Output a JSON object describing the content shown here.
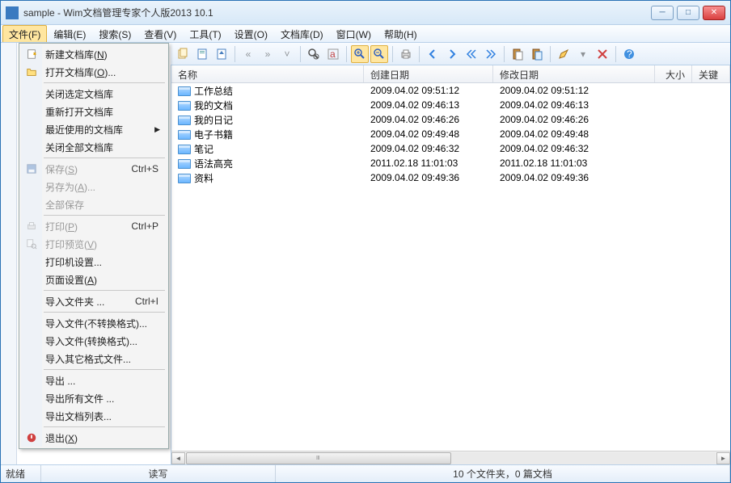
{
  "title": "sample - Wim文档管理专家个人版2013 10.1",
  "menubar": [
    "文件(F)",
    "编辑(E)",
    "搜索(S)",
    "查看(V)",
    "工具(T)",
    "设置(O)",
    "文档库(D)",
    "窗口(W)",
    "帮助(H)"
  ],
  "file_menu": {
    "groups": [
      [
        {
          "label": "新建文档库(N)",
          "icon": "new"
        },
        {
          "label": "打开文档库(O)...",
          "icon": "open"
        }
      ],
      [
        {
          "label": "关闭选定文档库"
        },
        {
          "label": "重新打开文档库"
        },
        {
          "label": "最近使用的文档库",
          "submenu": true
        },
        {
          "label": "关闭全部文档库"
        }
      ],
      [
        {
          "label": "保存(S)",
          "shortcut": "Ctrl+S",
          "icon": "save",
          "disabled": true
        },
        {
          "label": "另存为(A)...",
          "disabled": true
        },
        {
          "label": "全部保存",
          "disabled": true
        }
      ],
      [
        {
          "label": "打印(P)",
          "shortcut": "Ctrl+P",
          "icon": "print",
          "disabled": true
        },
        {
          "label": "打印预览(V)",
          "icon": "preview",
          "disabled": true
        },
        {
          "label": "打印机设置..."
        },
        {
          "label": "页面设置(A)"
        }
      ],
      [
        {
          "label": "导入文件夹 ...",
          "shortcut": "Ctrl+I"
        }
      ],
      [
        {
          "label": "导入文件(不转换格式)..."
        },
        {
          "label": "导入文件(转换格式)..."
        },
        {
          "label": "导入其它格式文件..."
        }
      ],
      [
        {
          "label": "导出 ..."
        },
        {
          "label": "导出所有文件 ..."
        },
        {
          "label": "导出文档列表..."
        }
      ],
      [
        {
          "label": "退出(X)",
          "icon": "exit"
        }
      ]
    ]
  },
  "columns": {
    "name": "名称",
    "created": "创建日期",
    "modified": "修改日期",
    "size": "大小",
    "keyword": "关键字"
  },
  "rows": [
    {
      "name": "工作总结",
      "created": "2009.04.02 09:51:12",
      "modified": "2009.04.02 09:51:12"
    },
    {
      "name": "我的文档",
      "created": "2009.04.02 09:46:13",
      "modified": "2009.04.02 09:46:13"
    },
    {
      "name": "我的日记",
      "created": "2009.04.02 09:46:26",
      "modified": "2009.04.02 09:46:26"
    },
    {
      "name": "电子书籍",
      "created": "2009.04.02 09:49:48",
      "modified": "2009.04.02 09:49:48"
    },
    {
      "name": "笔记",
      "created": "2009.04.02 09:46:32",
      "modified": "2009.04.02 09:46:32"
    },
    {
      "name": "语法高亮",
      "created": "2011.02.18 11:01:03",
      "modified": "2011.02.18 11:01:03"
    },
    {
      "name": "资料",
      "created": "2009.04.02 09:49:36",
      "modified": "2009.04.02 09:49:36"
    }
  ],
  "status": {
    "ready": "就绪",
    "rw": "读写",
    "count": "10 个文件夹，0 篇文档"
  }
}
